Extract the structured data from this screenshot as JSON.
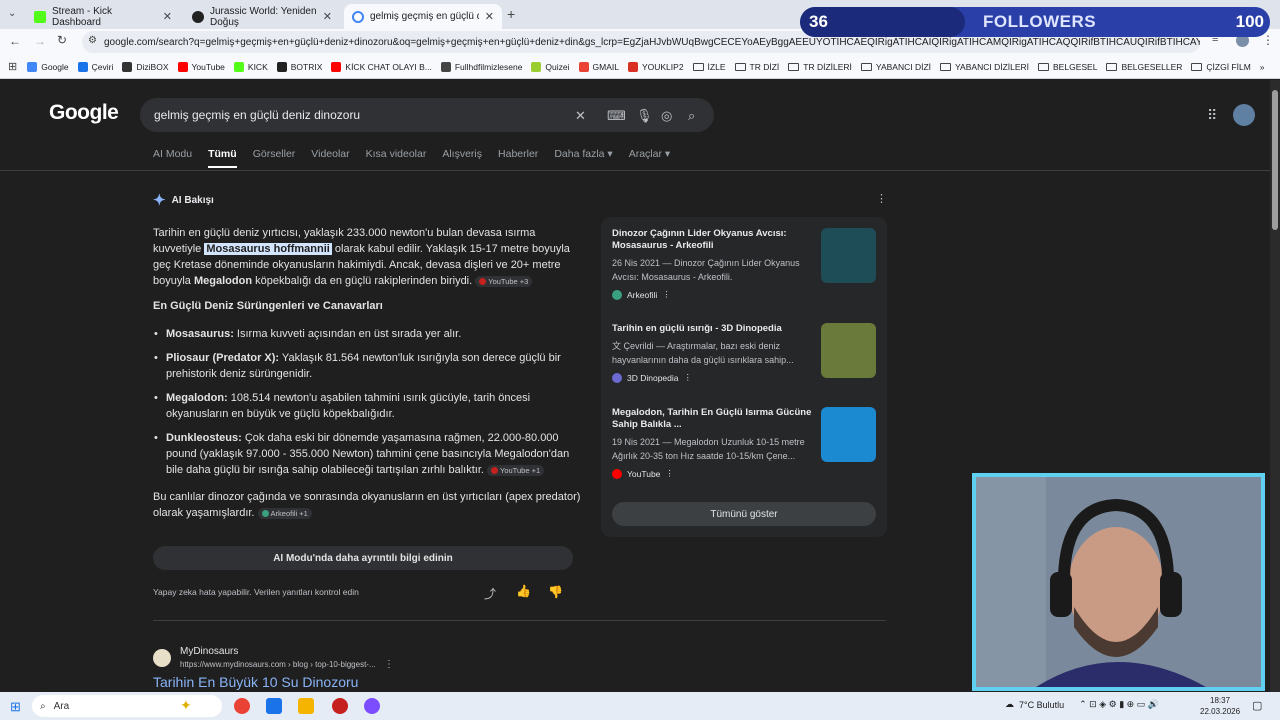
{
  "tabs": [
    {
      "title": "Stream - Kick Dashboard",
      "color": "#53fc18"
    },
    {
      "title": "Jurassic World: Yeniden Doğuş",
      "color": "#222222"
    },
    {
      "title": "gelmiş geçmiş en güçlü deniz d",
      "color": "#4285f4"
    }
  ],
  "omnibox": {
    "url": "google.com/search?q=gelmiş+geçmiş+en+güçlü+deniz+dinozoru&oq=gelmiş+geçmiş+en+güçlü+deniz+din&gs_lcrp=EgZjaHJvbWUqBwgCECEYoAEyBggAEEUYOTIHCAEQIRigATIHCAIQIRigATIHCAMQIRigATIHCAQQIRifBTIHCAUQIRifBTIHCAYQIRifBTIHCAcQIRi"
  },
  "bookmarks": [
    {
      "label": "Google",
      "kind": "icon",
      "color": "#4285f4"
    },
    {
      "label": "Çeviri",
      "kind": "icon",
      "color": "#1a73e8"
    },
    {
      "label": "DiziBOX",
      "kind": "icon",
      "color": "#333333"
    },
    {
      "label": "YouTube",
      "kind": "icon",
      "color": "#ff0000"
    },
    {
      "label": "KICK",
      "kind": "icon",
      "color": "#53fc18"
    },
    {
      "label": "BOTRIX",
      "kind": "icon",
      "color": "#222222"
    },
    {
      "label": "KİCK CHAT OLAYI B...",
      "kind": "icon",
      "color": "#ff0000"
    },
    {
      "label": "Fullhdfilmizlesene",
      "kind": "icon",
      "color": "#444444"
    },
    {
      "label": "Quizei",
      "kind": "icon",
      "color": "#9acd32"
    },
    {
      "label": "GMAIL",
      "kind": "icon",
      "color": "#ea4335"
    },
    {
      "label": "YOUKLIP2",
      "kind": "icon",
      "color": "#d93025"
    },
    {
      "label": "İZLE",
      "kind": "folder"
    },
    {
      "label": "TR DİZİ",
      "kind": "folder"
    },
    {
      "label": "TR DİZİLERİ",
      "kind": "folder"
    },
    {
      "label": "YABANCI DİZİ",
      "kind": "folder"
    },
    {
      "label": "YABANCI DİZİLERİ",
      "kind": "folder"
    },
    {
      "label": "BELGESEL",
      "kind": "folder"
    },
    {
      "label": "BELGESELLER",
      "kind": "folder"
    },
    {
      "label": "ÇİZGİ FİLM",
      "kind": "folder"
    }
  ],
  "followers": {
    "count": "36",
    "label": "FOLLOWERS",
    "goal": "100"
  },
  "google": {
    "logo": "Google",
    "query": "gelmiş geçmiş en güçlü deniz dinozoru",
    "nav": [
      "AI Modu",
      "Tümü",
      "Görseller",
      "Videolar",
      "Kısa videolar",
      "Alışveriş",
      "Haberler",
      "Daha fazla ▾",
      "Araçlar ▾"
    ],
    "ai_title": "AI Bakışı",
    "ai_p1a": "Tarihin en güçlü deniz yırtıcısı, yaklaşık 233.000 newton'u bulan devasa ısırma kuvvetiyle ",
    "ai_p1_hl": "Mosasaurus hoffmannii",
    "ai_p1b": " olarak kabul edilir. Yaklaşık 15-17 metre boyuyla geç Kretase döneminde okyanusların hakimiydi. Ancak, devasa dişleri ve 20+ metre boyuyla ",
    "ai_p1_bold": "Megalodon",
    "ai_p1c": " köpekbalığı da en güçlü rakiplerinden biriydi.",
    "chip1": "YouTube +3",
    "section": "En Güçlü Deniz Sürüngenleri ve Canavarları",
    "bullets": [
      {
        "b": "Mosasaurus:",
        "t": " Isırma kuvveti açısından en üst sırada yer alır.",
        "chip": ""
      },
      {
        "b": "Pliosaur (Predator X):",
        "t": " Yaklaşık 81.564 newton'luk ısırığıyla son derece güçlü bir prehistorik deniz sürüngenidir.",
        "chip": ""
      },
      {
        "b": "Megalodon:",
        "t": " 108.514 newton'u aşabilen tahmini ısırık gücüyle, tarih öncesi okyanusların en büyük ve güçlü köpekbalığıdır.",
        "chip": ""
      },
      {
        "b": "Dunkleosteus:",
        "t": " Çok daha eski bir dönemde yaşamasına rağmen, 22.000-80.000 pound (yaklaşık 97.000 - 355.000 Newton) tahmini çene basıncıyla Megalodon'dan bile daha güçlü bir ısırığa sahip olabileceği tartışılan zırhlı balıktır.",
        "chip": "YouTube +1"
      }
    ],
    "closing": "Bu canlılar dinozor çağında ve sonrasında okyanusların en üst yırtıcıları (apex predator) olarak yaşamışlardır.",
    "chip_closing": "Arkeofili +1",
    "ai_mode_btn": "AI Modu'nda daha ayrıntılı bilgi edinin",
    "disclaimer": "Yapay zeka hata yapabilir. Verilen yanıtları kontrol edin",
    "sources": [
      {
        "title": "Dinozor Çağının Lider Okyanus Avcısı: Mosasaurus - Arkeofili",
        "desc": "26 Nis 2021 — Dinozor Çağının Lider Okyanus Avcısı: Mosasaurus - Arkeofili.",
        "site": "Arkeofili",
        "color": "#3aa17e",
        "thumb": "#1f4d57"
      },
      {
        "title": "Tarihin en güçlü ısırığı - 3D Dinopedia",
        "desc": "文 Çevrildi — Araştırmalar, bazı eski deniz hayvanlarının daha da güçlü ısırıklara sahip...",
        "site": "3D Dinopedia",
        "color": "#6b6bd1",
        "thumb": "#6a7a3a"
      },
      {
        "title": "Megalodon, Tarihin En Güçlü Isırma Gücüne Sahip Balıkla ...",
        "desc": "19 Nis 2021 — Megalodon Uzunluk 10-15 metre Ağırlık 20-35 ton Hız saatde 10-15/km Çene...",
        "site": "YouTube",
        "color": "#ff0000",
        "thumb": "#1b8ad1"
      }
    ],
    "show_all": "Tümünü göster",
    "result": {
      "name": "MyDinosaurs",
      "url": "https://www.mydinosaurs.com › blog › top-10-biggest-...",
      "title": "Tarihin En Büyük 10 Su Dinozoru"
    }
  },
  "taskbar": {
    "search": "Ara",
    "weather": "7°C  Bulutlu",
    "time": "18:37",
    "date": "22.03.2026"
  }
}
